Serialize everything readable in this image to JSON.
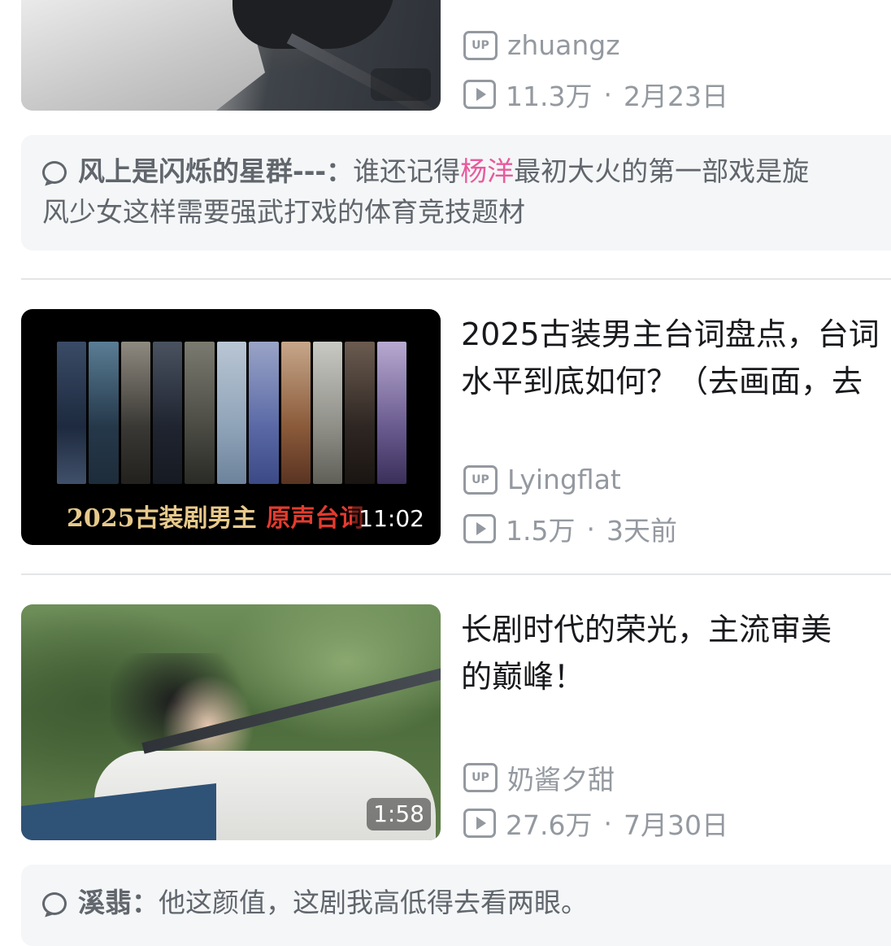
{
  "feed": {
    "items": [
      {
        "author": "zhuangz",
        "views": "11.3万",
        "date": "2月23日",
        "duration": ""
      },
      {
        "title_line1": "2025古装男主台词盘点，台词",
        "title_line2": "水平到底如何？（去画面，去",
        "thumb_caption_part1": "2025古装剧男主",
        "thumb_caption_part2": "原声台词",
        "duration": "11:02",
        "author": "Lyingflat",
        "views": "1.5万",
        "date": "3天前"
      },
      {
        "title_line1": "长剧时代的荣光，主流审美",
        "title_line2": "的巅峰！",
        "duration": "1:58",
        "author": "奶酱夕甜",
        "views": "27.6万",
        "date": "7月30日"
      }
    ],
    "comments": [
      {
        "author": "风上是闪烁的星群---：",
        "text_before": "谁还记得",
        "highlight": "杨洋",
        "text_after": "最初大火的第一部戏是旋",
        "line2": "风少女这样需要强武打戏的体育竞技题材"
      },
      {
        "author": "溪翡：",
        "text": "他这颜值，这剧我高低得去看两眼。"
      }
    ],
    "up_label": "UP",
    "separator": "·"
  },
  "colors": {
    "meta_gray": "#9499a0",
    "comment_bg": "#f4f6f7",
    "highlight_pink": "#e85a9d",
    "caption_gold": "#e7c98b",
    "caption_red": "#e23b2e"
  },
  "icons": [
    "up-badge-icon",
    "play-count-icon",
    "comment-bubble-icon"
  ]
}
